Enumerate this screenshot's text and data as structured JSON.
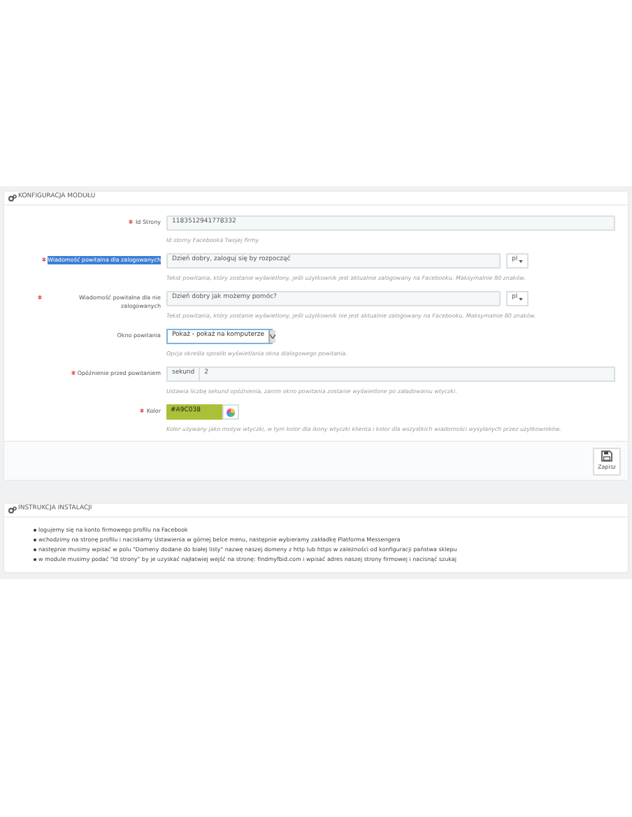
{
  "config_panel": {
    "title": "KONFIGURACJA MODUŁU",
    "fields": [
      {
        "kind": "text",
        "label": "Id Strony",
        "required": true,
        "label_selected": false,
        "value": "1183512941778332",
        "help": "Id storny Facebooka Twojej firmy"
      },
      {
        "kind": "text_lang",
        "label": "Wiadomość powitalna dla zalogowanych",
        "required": true,
        "label_selected": true,
        "value": "Dzień dobry, zaloguj się by rozpocząć",
        "lang": "pl",
        "help": "Tekst powitania, który zostanie wyświetlony, jeśli użytkownik jest aktualnie zalogowany na Facebooku. Maksymalnie 80 znaków."
      },
      {
        "kind": "text_lang",
        "label": "Wiadomość powitalna dla nie zalogowanych",
        "required": true,
        "label_selected": false,
        "value": "Dzień dobry jak możemy pomóc?",
        "lang": "pl",
        "help": "Tekst powitania, który zostanie wyświetlony, jeśli użytkownik nie jest aktualnie zalogowany na Facebooku. Maksymalnie 80 znaków."
      },
      {
        "kind": "select",
        "label": "Okno powitania",
        "required": false,
        "label_selected": false,
        "value": "Pokaż - pokaż na komputerze",
        "help": "Opcja określa sposób wyświetlania okna dialogowego powitania."
      },
      {
        "kind": "prefix",
        "label": "Opóźnienie przed powitaniem",
        "required": true,
        "label_selected": false,
        "prefix": "sekund",
        "value": "2",
        "help": "Ustawia liczbę sekund opóźnienia, zanim okno powitania zostanie wyświetlone po załadowaniu wtyczki."
      },
      {
        "kind": "color",
        "label": "Kolor",
        "required": true,
        "label_selected": false,
        "value": "#A9C038",
        "color": "#a9c038",
        "help": "Kolor używany jako motyw wtyczki, w tym kolor dla ikony wtyczki klienta i kolor dla wszystkich wiadomości wysyłanych przez użytkowników."
      }
    ],
    "save_button": "Zapisz"
  },
  "install_panel": {
    "title": "INSTRUKCJA INSTALACJI",
    "steps": [
      "logujemy się na konto firmowego profilu na Facebook",
      "wchodzimy na stronę profilu i naciskamy Ustawienia w górnej belce menu, następnie wybieramy zakładkę Platforma Messengera",
      "następnie musimy wpisać w polu \"Domeny dodane do białej listy\" nazwę naszej domeny z http lub https w zależności od konfiguracji państwa sklepu",
      "w module musimy podać \"Id strony\" by je uzyskać najłatwiej wejść na stronę: findmyfbid.com i wpisać adres naszej strony firmowej i nacisnąć szukaj"
    ]
  }
}
